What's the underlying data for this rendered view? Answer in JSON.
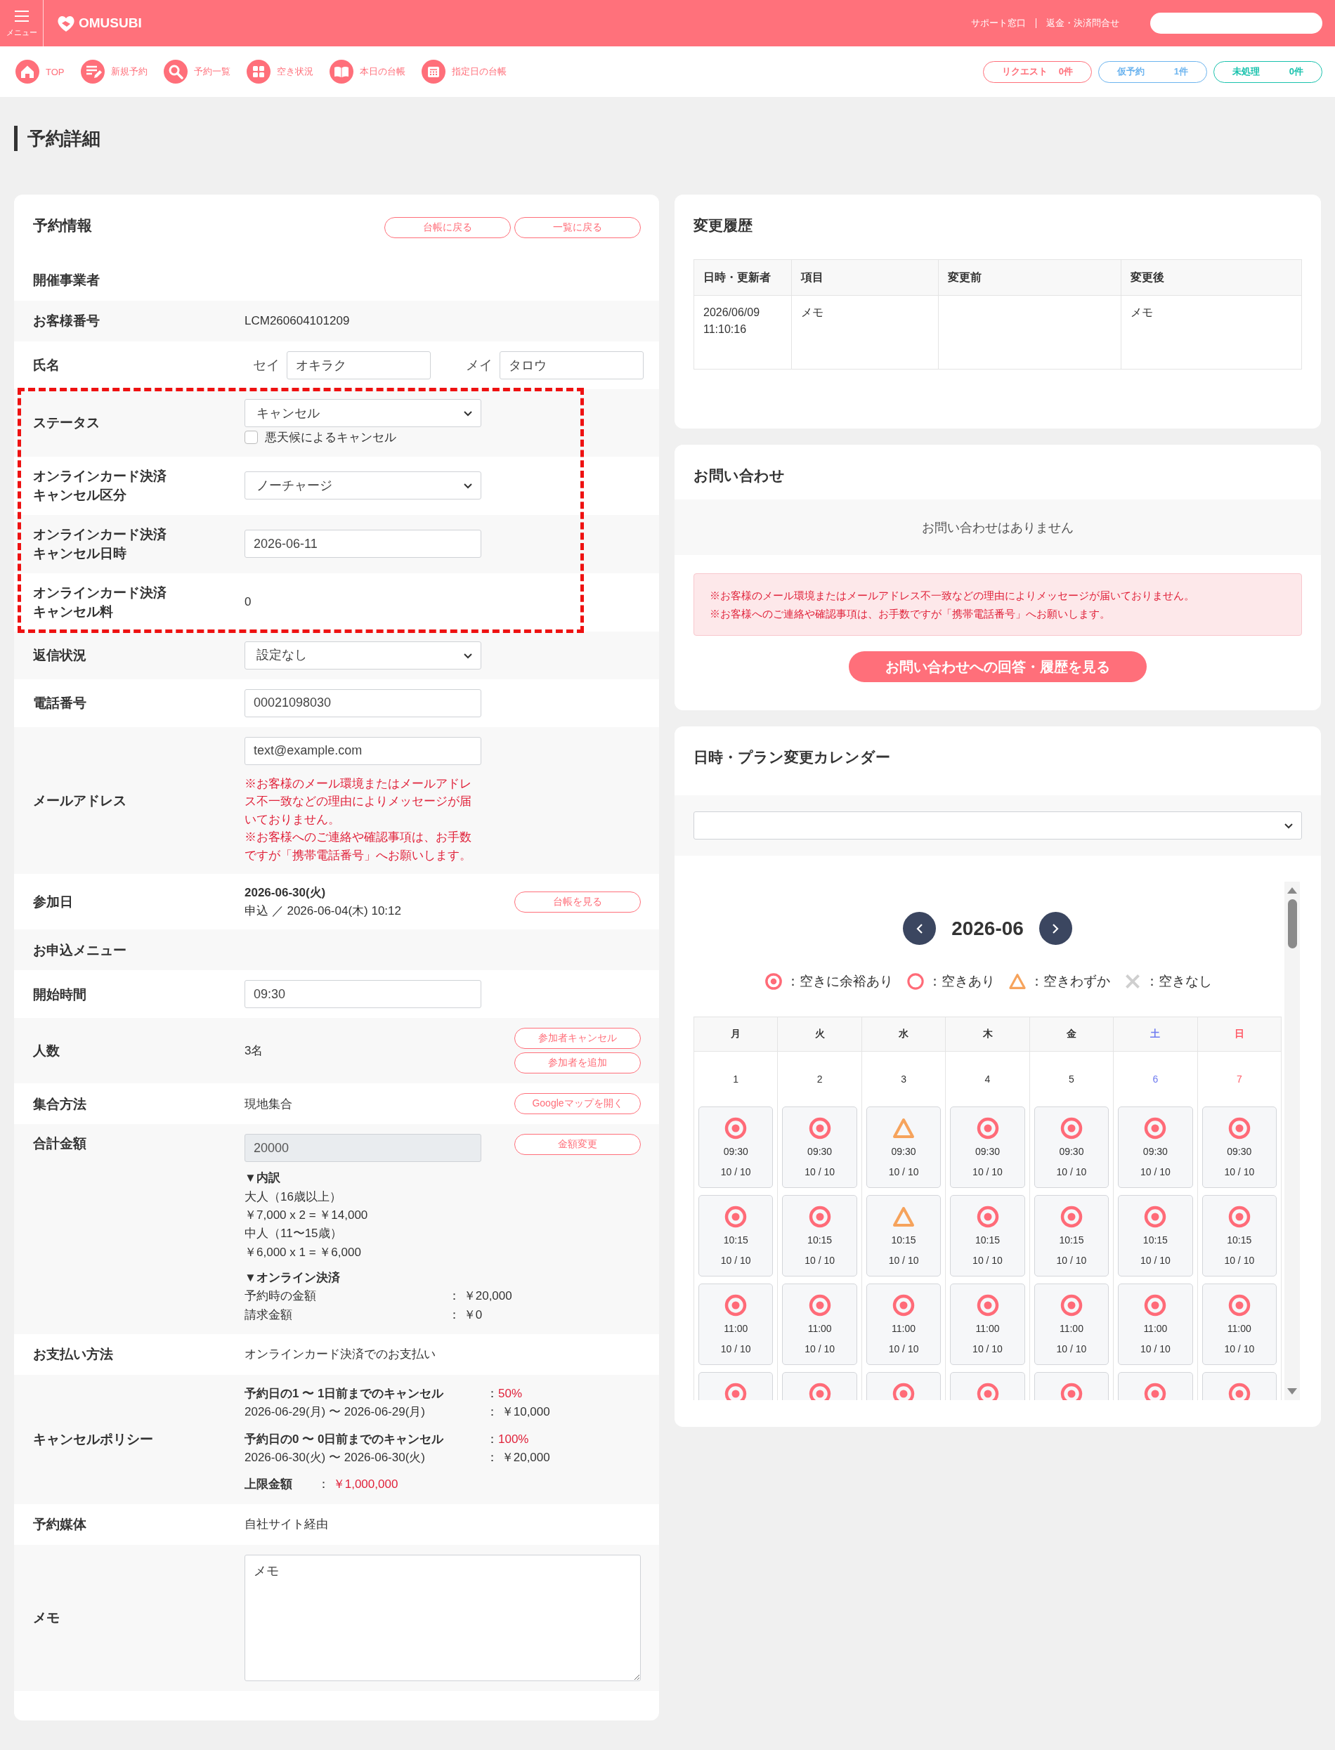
{
  "header": {
    "menu_label": "メニュー",
    "logo": "OMUSUBI",
    "links": [
      "サポート窓口",
      "返金・決済問合せ"
    ]
  },
  "nav": {
    "items": [
      "TOP",
      "新規予約",
      "予約一覧",
      "空き状況",
      "本日の台帳",
      "指定日の台帳"
    ],
    "badges": [
      {
        "label": "リクエスト",
        "count": "0件",
        "color": "#ff6f7a"
      },
      {
        "label": "仮予約",
        "count": "1件",
        "color": "#6cb4ef"
      },
      {
        "label": "未処理",
        "count": "0件",
        "color": "#19c2ad"
      }
    ]
  },
  "page_title": "予約詳細",
  "reservation": {
    "title": "予約情報",
    "buttons": [
      "台帳に戻る",
      "一覧に戻る"
    ],
    "separator": "：",
    "rows": [
      {
        "kind": "text",
        "label": "開催事業者",
        "highlighted": false
      },
      {
        "kind": "text",
        "label": "お客様番号",
        "value": "LCM260604101209",
        "highlighted": false
      },
      {
        "kind": "name",
        "label": "氏名",
        "fields": [
          {
            "prefix": "セイ",
            "value": "オキラク"
          },
          {
            "prefix": "メイ",
            "value": "タロウ"
          }
        ],
        "highlighted": false
      },
      {
        "kind": "select",
        "label": "ステータス",
        "value": "キャンセル",
        "checkbox": {
          "label": "悪天候によるキャンセル",
          "checked": false
        },
        "highlighted": true
      },
      {
        "kind": "select",
        "label": "オンラインカード決済キャンセル区分",
        "value": "ノーチャージ",
        "highlighted": true
      },
      {
        "kind": "input",
        "label": "オンラインカード決済キャンセル日時",
        "value": "2026-06-11",
        "highlighted": true
      },
      {
        "kind": "text",
        "label": "オンラインカード決済キャンセル料",
        "value": "0",
        "highlighted": true
      },
      {
        "kind": "select",
        "label": "返信状況",
        "value": "設定なし",
        "highlighted": false
      },
      {
        "kind": "input",
        "label": "電話番号",
        "value": "00021098030",
        "highlighted": false
      },
      {
        "kind": "email",
        "label": "メールアドレス",
        "value": "text@example.com",
        "notes": [
          "※お客様のメール環境またはメールアドレス不一致などの理由によりメッセージが届いておりません。",
          "※お客様へのご連絡や確認事項は、お手数ですが「携帯電話番号」へお願いします。"
        ],
        "highlighted": false
      },
      {
        "kind": "date",
        "label": "参加日",
        "value": "2026-06-30(火)",
        "sub": "申込 ／ 2026-06-04(木) 10:12",
        "buttons": [
          "台帳を見る"
        ],
        "highlighted": false
      },
      {
        "kind": "text",
        "label": "お申込メニュー",
        "highlighted": false
      },
      {
        "kind": "input",
        "label": "開始時間",
        "value": "09:30",
        "highlighted": false
      },
      {
        "kind": "text",
        "label": "人数",
        "value": "3名",
        "buttons": [
          "参加者キャンセル",
          "参加者を追加"
        ],
        "highlighted": false
      },
      {
        "kind": "text",
        "label": "集合方法",
        "value": "現地集合",
        "buttons": [
          "Googleマップを開く"
        ],
        "highlighted": false
      },
      {
        "kind": "amount",
        "label": "合計金額",
        "value": "20000",
        "disabled": true,
        "buttons": [
          "金額変更"
        ],
        "breakdown": {
          "title": "▼内訳",
          "lines": [
            "大人（16歳以上）",
            "￥7,000 x 2 = ￥14,000",
            "中人（11〜15歳）",
            "￥6,000 x 1 = ￥6,000"
          ]
        },
        "online": {
          "title": "▼オンライン決済",
          "lines": [
            {
              "label": "予約時の金額",
              "value": "￥20,000"
            },
            {
              "label": "請求金額",
              "value": "￥0"
            }
          ]
        },
        "highlighted": false
      },
      {
        "kind": "text",
        "label": "お支払い方法",
        "value": "オンラインカード決済でのお支払い",
        "highlighted": false
      },
      {
        "kind": "policy",
        "label": "キャンセルポリシー",
        "rules": [
          {
            "title": "予約日の1 〜 1日前までのキャンセル",
            "rate": "50%",
            "period": "2026-06-29(月) 〜 2026-06-29(月)",
            "fee": "￥10,000"
          },
          {
            "title": "予約日の0 〜 0日前までのキャンセル",
            "rate": "100%",
            "period": "2026-06-30(火) 〜 2026-06-30(火)",
            "fee": "￥20,000"
          }
        ],
        "cap": {
          "label": "上限金額",
          "value": "￥1,000,000"
        },
        "highlighted": false
      },
      {
        "kind": "text",
        "label": "予約媒体",
        "value": "自社サイト経由",
        "highlighted": false
      },
      {
        "kind": "memo",
        "label": "メモ",
        "value": "メモ",
        "highlighted": false
      }
    ]
  },
  "history": {
    "title": "変更履歴",
    "columns": [
      "日時・更新者",
      "項目",
      "変更前",
      "変更後"
    ],
    "rows": [
      {
        "date": "2026/06/09\n11:10:16",
        "item": "メモ",
        "after": "メモ"
      }
    ]
  },
  "inquiry": {
    "title": "お問い合わせ",
    "empty_message": "お問い合わせはありません",
    "warnings": [
      "※お客様のメール環境またはメールアドレス不一致などの理由によりメッセージが届いておりません。",
      "※お客様へのご連絡や確認事項は、お手数ですが「携帯電話番号」へお願いします。"
    ],
    "button": "お問い合わせへの回答・履歴を見る"
  },
  "calendar": {
    "title": "日時・プラン変更カレンダー",
    "month": "2026-06",
    "legend": [
      {
        "kind": "double",
        "label": "：空きに余裕あり"
      },
      {
        "kind": "circle",
        "label": "：空きあり"
      },
      {
        "kind": "triangle",
        "label": "：空きわずか"
      },
      {
        "kind": "cross",
        "label": "：空きなし"
      }
    ],
    "weekdays": [
      {
        "label": "月",
        "kind": "weekday"
      },
      {
        "label": "火",
        "kind": "weekday"
      },
      {
        "label": "水",
        "kind": "weekday"
      },
      {
        "label": "木",
        "kind": "weekday"
      },
      {
        "label": "金",
        "kind": "weekday"
      },
      {
        "label": "土",
        "kind": "saturday"
      },
      {
        "label": "日",
        "kind": "sunday"
      }
    ],
    "days": [
      {
        "date": "1",
        "slots": [
          {
            "kind": "double",
            "time": "09:30",
            "count": "10 / 10"
          },
          {
            "kind": "double",
            "time": "10:15",
            "count": "10 / 10"
          },
          {
            "kind": "double",
            "time": "11:00",
            "count": "10 / 10"
          },
          {
            "kind": "double"
          }
        ]
      },
      {
        "date": "2",
        "slots": [
          {
            "kind": "double",
            "time": "09:30",
            "count": "10 / 10"
          },
          {
            "kind": "double",
            "time": "10:15",
            "count": "10 / 10"
          },
          {
            "kind": "double",
            "time": "11:00",
            "count": "10 / 10"
          },
          {
            "kind": "double"
          }
        ]
      },
      {
        "date": "3",
        "slots": [
          {
            "kind": "triangle",
            "time": "09:30",
            "count": "10 / 10"
          },
          {
            "kind": "triangle",
            "time": "10:15",
            "count": "10 / 10"
          },
          {
            "kind": "double",
            "time": "11:00",
            "count": "10 / 10"
          },
          {
            "kind": "double"
          }
        ]
      },
      {
        "date": "4",
        "slots": [
          {
            "kind": "double",
            "time": "09:30",
            "count": "10 / 10"
          },
          {
            "kind": "double",
            "time": "10:15",
            "count": "10 / 10"
          },
          {
            "kind": "double",
            "time": "11:00",
            "count": "10 / 10"
          },
          {
            "kind": "double"
          }
        ]
      },
      {
        "date": "5",
        "slots": [
          {
            "kind": "double",
            "time": "09:30",
            "count": "10 / 10"
          },
          {
            "kind": "double",
            "time": "10:15",
            "count": "10 / 10"
          },
          {
            "kind": "double",
            "time": "11:00",
            "count": "10 / 10"
          },
          {
            "kind": "double"
          }
        ]
      },
      {
        "date": "6",
        "slots": [
          {
            "kind": "double",
            "time": "09:30",
            "count": "10 / 10"
          },
          {
            "kind": "double",
            "time": "10:15",
            "count": "10 / 10"
          },
          {
            "kind": "double",
            "time": "11:00",
            "count": "10 / 10"
          },
          {
            "kind": "double"
          }
        ]
      },
      {
        "date": "7",
        "slots": [
          {
            "kind": "double",
            "time": "09:30",
            "count": "10 / 10"
          },
          {
            "kind": "double",
            "time": "10:15",
            "count": "10 / 10"
          },
          {
            "kind": "double",
            "time": "11:00",
            "count": "10 / 10"
          },
          {
            "kind": "double"
          }
        ]
      }
    ]
  }
}
